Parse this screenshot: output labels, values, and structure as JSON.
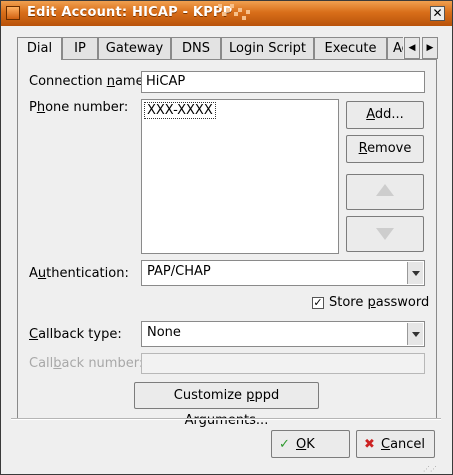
{
  "window": {
    "title": "Edit Account: HICAP - KPPP",
    "close_glyph": "✕"
  },
  "tabs": [
    "Dial",
    "IP",
    "Gateway",
    "DNS",
    "Login Script",
    "Execute",
    "Ac"
  ],
  "tab_scroll": {
    "left_glyph": "◀",
    "right_glyph": "▶"
  },
  "connection_name": {
    "label_pre": "Connection ",
    "label_key": "n",
    "label_post": "ame:",
    "value": "HiCAP"
  },
  "phone_number": {
    "label_pre": "P",
    "label_key": "h",
    "label_post": "one number:",
    "items": [
      "XXX-XXXX"
    ]
  },
  "buttons": {
    "add": {
      "key": "A",
      "rest": "dd..."
    },
    "remove": {
      "key": "R",
      "rest": "emove"
    }
  },
  "authentication": {
    "label_pre": "A",
    "label_key": "u",
    "label_post": "thentication:",
    "value": "PAP/CHAP"
  },
  "store_password": {
    "label_pre": "Store ",
    "label_key": "p",
    "label_post": "assword",
    "checked": true,
    "check_glyph": "✓"
  },
  "callback_type": {
    "label_key": "C",
    "label_post": "allback type:",
    "value": "None"
  },
  "callback_number": {
    "label_pre": "Call",
    "label_key": "b",
    "label_post": "ack number:",
    "value": ""
  },
  "customize": {
    "label_pre": "Customize ",
    "label_key": "p",
    "label_post": "ppd Arguments..."
  },
  "ok": {
    "key": "O",
    "rest": "K",
    "icon_glyph": "✓",
    "icon_color": "#2f9a2f"
  },
  "cancel": {
    "key": "C",
    "rest": "ancel",
    "icon_glyph": "✖",
    "icon_color": "#cc2222"
  },
  "colors": {
    "titlebar_accent": "#d96f1a",
    "dialog_bg": "#efefef"
  }
}
